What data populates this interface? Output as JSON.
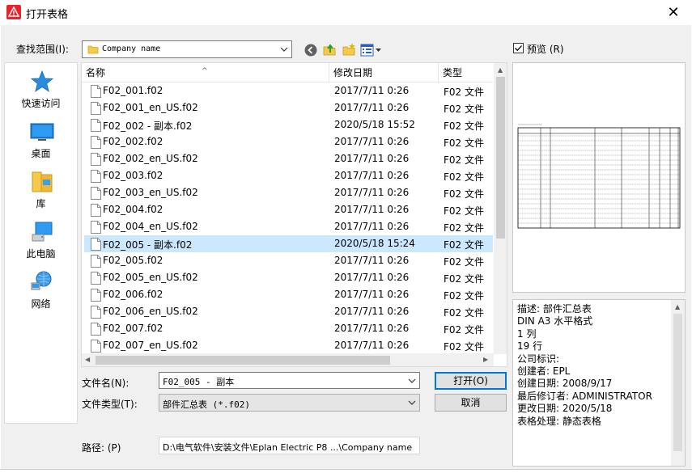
{
  "window": {
    "title": "打开表格",
    "close_glyph": "✕"
  },
  "toolbar": {
    "lookin_label": "查找范围(I):",
    "lookin_value": "Company name"
  },
  "preview": {
    "checkbox_label": "预览 (R)",
    "checked": true
  },
  "places": [
    {
      "label": "快速访问",
      "icon": "star-icon"
    },
    {
      "label": "桌面",
      "icon": "desktop-icon"
    },
    {
      "label": "库",
      "icon": "library-icon"
    },
    {
      "label": "此电脑",
      "icon": "computer-icon"
    },
    {
      "label": "网络",
      "icon": "network-icon"
    }
  ],
  "columns": {
    "name": "名称",
    "date": "修改日期",
    "type": "类型"
  },
  "files": [
    {
      "name": "F02_001.f02",
      "date": "2017/7/11 0:26",
      "type": "F02 文件"
    },
    {
      "name": "F02_001_en_US.f02",
      "date": "2017/7/11 0:26",
      "type": "F02 文件"
    },
    {
      "name": "F02_002 - 副本.f02",
      "date": "2020/5/18 15:52",
      "type": "F02 文件"
    },
    {
      "name": "F02_002.f02",
      "date": "2017/7/11 0:26",
      "type": "F02 文件"
    },
    {
      "name": "F02_002_en_US.f02",
      "date": "2017/7/11 0:26",
      "type": "F02 文件"
    },
    {
      "name": "F02_003.f02",
      "date": "2017/7/11 0:26",
      "type": "F02 文件"
    },
    {
      "name": "F02_003_en_US.f02",
      "date": "2017/7/11 0:26",
      "type": "F02 文件"
    },
    {
      "name": "F02_004.f02",
      "date": "2017/7/11 0:26",
      "type": "F02 文件"
    },
    {
      "name": "F02_004_en_US.f02",
      "date": "2017/7/11 0:26",
      "type": "F02 文件"
    },
    {
      "name": "F02_005 - 副本.f02",
      "date": "2020/5/18 15:24",
      "type": "F02 文件",
      "selected": true
    },
    {
      "name": "F02_005.f02",
      "date": "2017/7/11 0:26",
      "type": "F02 文件"
    },
    {
      "name": "F02_005_en_US.f02",
      "date": "2017/7/11 0:26",
      "type": "F02 文件"
    },
    {
      "name": "F02_006.f02",
      "date": "2017/7/11 0:26",
      "type": "F02 文件"
    },
    {
      "name": "F02_006_en_US.f02",
      "date": "2017/7/11 0:26",
      "type": "F02 文件"
    },
    {
      "name": "F02_007.f02",
      "date": "2017/7/11 0:26",
      "type": "F02 文件"
    },
    {
      "name": "F02_007_en_US.f02",
      "date": "2017/7/11 0:26",
      "type": "F02 文件"
    }
  ],
  "form": {
    "filename_label": "文件名(N):",
    "filename_value": "F02_005 - 副本",
    "filetype_label": "文件类型(T):",
    "filetype_value": "部件汇总表 (*.f02)",
    "path_label": "路径: (P)",
    "path_value": "D:\\电气软件\\安装文件\\Eplan Electric P8 ...\\Company name"
  },
  "buttons": {
    "open": "打开(O)",
    "cancel": "取消"
  },
  "description": [
    "描述: 部件汇总表",
    "DIN A3 水平格式",
    "1 列",
    "19 行",
    "公司标识:",
    "创建者: EPL",
    "创建日期: 2008/9/17",
    "最后修订者: ADMINISTRATOR",
    "更改日期: 2020/5/18",
    "表格处理: 静态表格"
  ],
  "colors": {
    "selection": "#cce8ff",
    "accent": "#0078d7",
    "app_icon": "#e8232a"
  }
}
